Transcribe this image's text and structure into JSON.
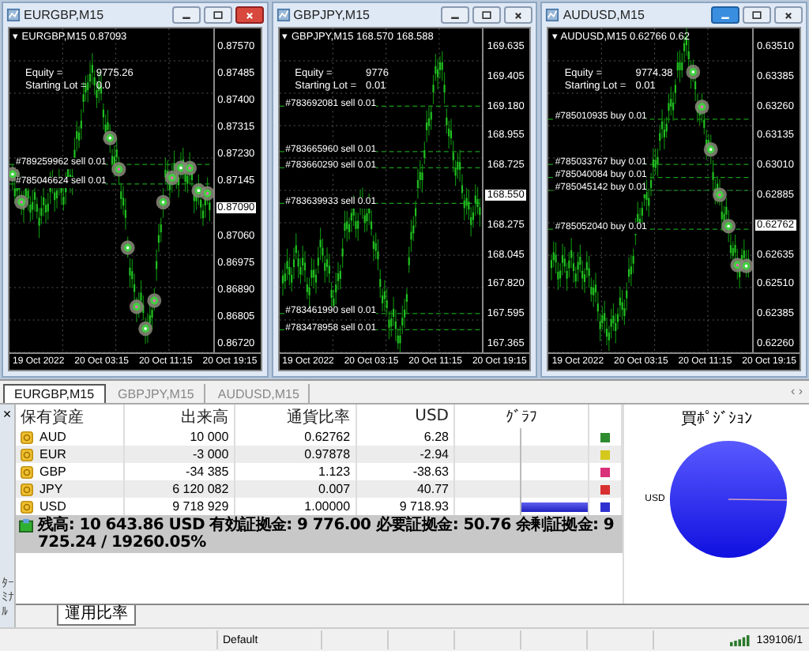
{
  "charts": [
    {
      "title": "EURGBP,M15",
      "header": "▾ EURGBP,M15  0.87093",
      "equity_label": "Equity =",
      "equity": "9775.26",
      "lot_label": "Starting Lot =",
      "lot": "0.0",
      "minimize_highlighted": false,
      "markers": true,
      "orders": [
        "#789259962 sell 0.01",
        "#785046624 sell 0.01"
      ],
      "price_axis": [
        {
          "label": "0.87570",
          "current": false
        },
        {
          "label": "0.87485",
          "current": false
        },
        {
          "label": "0.87400",
          "current": false
        },
        {
          "label": "0.87315",
          "current": false
        },
        {
          "label": "0.87230",
          "current": false
        },
        {
          "label": "0.87145",
          "current": false
        },
        {
          "label": "0.87090",
          "current": true
        },
        {
          "label": "0.87060",
          "current": false
        },
        {
          "label": "0.86975",
          "current": false
        },
        {
          "label": "0.86890",
          "current": false
        },
        {
          "label": "0.86805",
          "current": false
        },
        {
          "label": "0.86720",
          "current": false
        }
      ],
      "time_ticks": [
        "19 Oct 2022",
        "20 Oct 03:15",
        "20 Oct 11:15",
        "20 Oct 19:15"
      ]
    },
    {
      "title": "GBPJPY,M15",
      "header": "▾ GBPJPY,M15  168.570 168.588",
      "equity_label": "Equity =",
      "equity": "9776",
      "lot_label": "Starting Lot =",
      "lot": "0.01",
      "minimize_highlighted": false,
      "markers": false,
      "orders": [
        "#783692081 sell 0.01",
        "#783665960 sell 0.01",
        "#783660290 sell 0.01",
        "#783639933 sell 0.01",
        "#783461990 sell 0.01",
        "#783478958 sell 0.01"
      ],
      "price_axis": [
        {
          "label": "169.635",
          "current": false
        },
        {
          "label": "169.405",
          "current": false
        },
        {
          "label": "169.180",
          "current": false
        },
        {
          "label": "168.955",
          "current": false
        },
        {
          "label": "168.725",
          "current": false
        },
        {
          "label": "168.550",
          "current": true
        },
        {
          "label": "168.275",
          "current": false
        },
        {
          "label": "168.045",
          "current": false
        },
        {
          "label": "167.820",
          "current": false
        },
        {
          "label": "167.595",
          "current": false
        },
        {
          "label": "167.365",
          "current": false
        }
      ],
      "time_ticks": [
        "19 Oct 2022",
        "20 Oct 03:15",
        "20 Oct 11:15",
        "20 Oct 19:15"
      ]
    },
    {
      "title": "AUDUSD,M15",
      "header": "▾ AUDUSD,M15  0.62766 0.62",
      "equity_label": "Equity =",
      "equity": "9774.38",
      "lot_label": "Starting Lot =",
      "lot": "0.01",
      "minimize_highlighted": true,
      "markers": true,
      "orders": [
        "#785010935 buy 0.01",
        "#785033767 buy 0.01",
        "#785040084 buy 0.01",
        "#785045142 buy 0.01",
        "#785052040 buy 0.01"
      ],
      "price_axis": [
        {
          "label": "0.63510",
          "current": false
        },
        {
          "label": "0.63385",
          "current": false
        },
        {
          "label": "0.63260",
          "current": false
        },
        {
          "label": "0.63135",
          "current": false
        },
        {
          "label": "0.63010",
          "current": false
        },
        {
          "label": "0.62885",
          "current": false
        },
        {
          "label": "0.62762",
          "current": true
        },
        {
          "label": "0.62635",
          "current": false
        },
        {
          "label": "0.62510",
          "current": false
        },
        {
          "label": "0.62385",
          "current": false
        },
        {
          "label": "0.62260",
          "current": false
        }
      ],
      "time_ticks": [
        "19 Oct 2022",
        "20 Oct 03:15",
        "20 Oct 11:15",
        "20 Oct 19:15"
      ]
    }
  ],
  "chart_tabs": [
    {
      "label": "EURGBP,M15",
      "selected": true
    },
    {
      "label": "GBPJPY,M15",
      "selected": false
    },
    {
      "label": "AUDUSD,M15",
      "selected": false
    }
  ],
  "tab_scroll": "‹ ›",
  "terminal": {
    "close": "×",
    "label": "ﾀｰﾐﾅﾙ"
  },
  "table": {
    "columns": [
      "保有資産",
      "出来高",
      "通貨比率",
      "USD",
      "ｸﾞﾗﾌ"
    ],
    "rows": [
      {
        "asset": "AUD",
        "volume": "10 000",
        "rate": "0.62762",
        "usd": "6.28",
        "color": "#2e8b2e"
      },
      {
        "asset": "EUR",
        "volume": "-3 000",
        "rate": "0.97878",
        "usd": "-2.94",
        "color": "#d4c81c"
      },
      {
        "asset": "GBP",
        "volume": "-34 385",
        "rate": "1.123",
        "usd": "-38.63",
        "color": "#d8307a"
      },
      {
        "asset": "JPY",
        "volume": "6 120 082",
        "rate": "0.007",
        "usd": "40.77",
        "color": "#d83030"
      },
      {
        "asset": "USD",
        "volume": "9 718 929",
        "rate": "1.00000",
        "usd": "9 718.93",
        "level": 1,
        "color": "#3030d0"
      }
    ]
  },
  "summary": "残高: 10 643.86 USD  有効証拠金: 9 776.00  必要証拠金: 50.76  余剰証拠金: 9 725.24 / 19260.05%",
  "pie": {
    "title": "買ﾎﾟｼﾞｼｮﾝ",
    "label": "USD"
  },
  "bottom_tabs": [
    {
      "label": "運用比率",
      "selected": true
    }
  ],
  "status_bar": {
    "profile": "Default",
    "traffic": "139106/1"
  }
}
